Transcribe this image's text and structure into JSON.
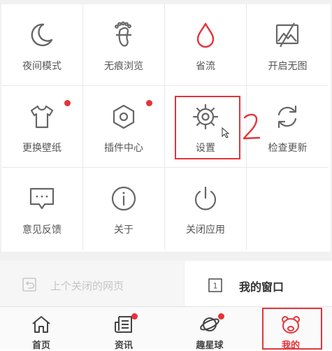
{
  "grid": {
    "items": [
      {
        "label": "夜间模式",
        "icon": "moon-icon"
      },
      {
        "label": "无痕浏览",
        "icon": "footprint-icon"
      },
      {
        "label": "省流",
        "icon": "drop-icon"
      },
      {
        "label": "开启无图",
        "icon": "no-image-icon"
      },
      {
        "label": "更换壁纸",
        "icon": "tshirt-icon",
        "badge": true
      },
      {
        "label": "插件中心",
        "icon": "hexagon-nut-icon",
        "badge": true
      },
      {
        "label": "设置",
        "icon": "gear-icon"
      },
      {
        "label": "检查更新",
        "icon": "refresh-icon"
      },
      {
        "label": "意见反馈",
        "icon": "chat-bubble-icon"
      },
      {
        "label": "关于",
        "icon": "info-icon"
      },
      {
        "label": "关闭应用",
        "icon": "power-icon"
      }
    ]
  },
  "annotation": {
    "number": "2",
    "color": "#e0353a"
  },
  "strip": {
    "last_closed": {
      "label": "上个关闭的网页",
      "icon": "undo-icon"
    },
    "my_window": {
      "label": "我的窗口",
      "count": "1",
      "icon": "window-count-icon"
    }
  },
  "tabs": [
    {
      "label": "首页",
      "icon": "home-icon"
    },
    {
      "label": "资讯",
      "icon": "news-icon",
      "badge": true
    },
    {
      "label": "趣星球",
      "icon": "planet-icon",
      "badge": true
    },
    {
      "label": "我的",
      "icon": "bear-face-icon",
      "active": true
    }
  ],
  "colors": {
    "accent": "#e6323a",
    "icon_gray": "#666666"
  }
}
